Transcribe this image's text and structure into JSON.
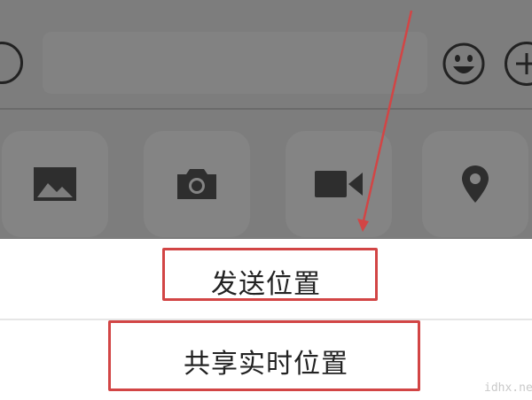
{
  "chat_input": {
    "voice_icon": "voice-icon",
    "emoji_icon": "emoji-icon",
    "plus_icon": "plus-icon"
  },
  "tools": [
    {
      "name": "photo",
      "icon": "image-icon"
    },
    {
      "name": "camera",
      "icon": "camera-icon"
    },
    {
      "name": "video",
      "icon": "video-camera-icon"
    },
    {
      "name": "location",
      "icon": "location-pin-icon"
    }
  ],
  "location_sheet": {
    "send_location": "发送位置",
    "share_live_location": "共享实时位置"
  },
  "watermark": "idhx.net",
  "colors": {
    "overlay_gray": "#7d7d7d",
    "highlight_red": "#d24545",
    "sheet_white": "#ffffff"
  }
}
